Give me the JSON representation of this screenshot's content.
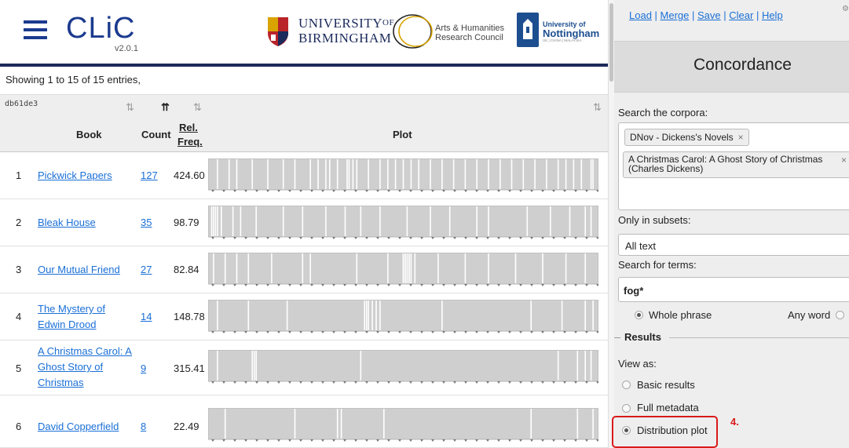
{
  "header": {
    "app_name": "CLiC",
    "version": "v2.0.1",
    "partner_1": {
      "line1": "UNIVERSITY",
      "of": "OF",
      "line2": "BIRMINGHAM"
    },
    "partner_2": {
      "line1": "Arts & Humanities",
      "line2": "Research Council"
    },
    "partner_3": {
      "line1": "University of",
      "line2": "Nottingham",
      "line3": "UK | CHINA | MALAYSIA"
    }
  },
  "table": {
    "info": "Showing 1 to 15 of 15 entries,",
    "id": "db61de3",
    "columns": {
      "book": "Book",
      "count": "Count",
      "rel_freq_1": "Rel.",
      "rel_freq_2": "Freq.",
      "plot": "Plot"
    },
    "rows": [
      {
        "num": "1",
        "book": "Pickwick Papers",
        "count": "127",
        "freq": "424.60"
      },
      {
        "num": "2",
        "book": "Bleak House",
        "count": "35",
        "freq": "98.79"
      },
      {
        "num": "3",
        "book": "Our Mutual Friend",
        "count": "27",
        "freq": "82.84"
      },
      {
        "num": "4",
        "book": "The Mystery of Edwin Drood",
        "count": "14",
        "freq": "148.78"
      },
      {
        "num": "5",
        "book": "A Christmas Carol: A Ghost Story of Christmas",
        "count": "9",
        "freq": "315.41"
      },
      {
        "num": "6",
        "book": "David Copperfield",
        "count": "8",
        "freq": "22.49"
      }
    ],
    "plot_hits": [
      [
        0.02,
        0.05,
        0.07,
        0.11,
        0.15,
        0.19,
        0.22,
        0.26,
        0.28,
        0.3,
        0.31,
        0.33,
        0.355,
        0.36,
        0.37,
        0.38,
        0.41,
        0.44,
        0.46,
        0.48,
        0.5,
        0.52,
        0.54,
        0.57,
        0.6,
        0.63,
        0.66,
        0.69,
        0.72,
        0.75,
        0.78,
        0.81,
        0.84,
        0.87,
        0.9,
        0.92,
        0.94,
        0.96,
        0.985,
        0.99
      ],
      [
        0.005,
        0.01,
        0.015,
        0.02,
        0.03,
        0.06,
        0.08,
        0.12,
        0.19,
        0.24,
        0.3,
        0.35,
        0.39,
        0.44,
        0.51,
        0.57,
        0.62,
        0.69,
        0.72,
        0.82,
        0.88,
        0.93,
        0.97,
        0.985
      ],
      [
        0.01,
        0.04,
        0.07,
        0.1,
        0.16,
        0.24,
        0.26,
        0.38,
        0.46,
        0.5,
        0.5,
        0.505,
        0.51,
        0.515,
        0.52,
        0.53,
        0.59,
        0.66,
        0.72,
        0.79,
        0.86,
        0.92,
        0.97
      ],
      [
        0.02,
        0.1,
        0.2,
        0.4,
        0.405,
        0.41,
        0.42,
        0.43,
        0.44,
        0.6,
        0.83,
        0.91,
        0.97,
        0.99
      ],
      [
        0.02,
        0.11,
        0.115,
        0.12,
        0.39,
        0.9,
        0.95,
        0.97,
        0.985
      ],
      [
        0.04,
        0.22,
        0.33,
        0.34,
        0.45,
        0.83,
        0.95,
        0.99
      ]
    ]
  },
  "side": {
    "menu": {
      "load": "Load",
      "merge": "Merge",
      "save": "Save",
      "clear": "Clear",
      "help": "Help"
    },
    "title": "Concordance",
    "search_corpora_label": "Search the corpora:",
    "corpora": [
      {
        "label": "DNov - Dickens's Novels"
      },
      {
        "label": "A Christmas Carol: A Ghost Story of Christmas (Charles Dickens)"
      }
    ],
    "subsets_label": "Only in subsets:",
    "subsets_value": "All text",
    "terms_label": "Search for terms:",
    "terms_value": "fog*",
    "whole_phrase": "Whole phrase",
    "any_word": "Any word",
    "results_legend": "Results",
    "view_as": "View as:",
    "options": [
      "Basic results",
      "Full metadata",
      "Distribution plot"
    ],
    "annotation": "4."
  },
  "colors": {
    "link": "#1a6fd6",
    "header_rule": "#1b2a5b",
    "highlight": "#d91a1a",
    "plot_bar": "#cfcfcf"
  }
}
